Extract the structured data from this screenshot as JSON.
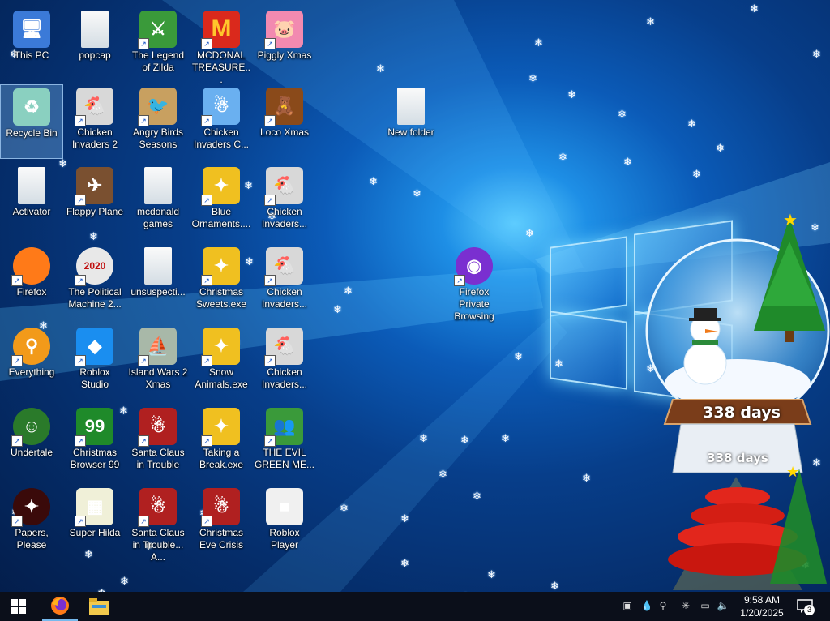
{
  "desktop": {
    "icons": [
      {
        "label": "This PC",
        "icon": "computer-icon",
        "shortcut": false
      },
      {
        "label": "Recycle Bin",
        "icon": "recycle-bin-icon",
        "shortcut": false
      },
      {
        "label": "Activator",
        "icon": "folder-icon",
        "shortcut": false
      },
      {
        "label": "Firefox",
        "icon": "firefox-icon",
        "shortcut": true
      },
      {
        "label": "Everything",
        "icon": "everything-search-icon",
        "shortcut": true
      },
      {
        "label": "Undertale",
        "icon": "undertale-icon",
        "shortcut": true
      },
      {
        "label": "Papers, Please",
        "icon": "papers-please-icon",
        "shortcut": true
      },
      {
        "label": "popcap",
        "icon": "folder-icon",
        "shortcut": false
      },
      {
        "label": "Chicken Invaders 2",
        "icon": "chicken-invaders-icon",
        "shortcut": true
      },
      {
        "label": "Flappy Plane",
        "icon": "flappy-plane-icon",
        "shortcut": true
      },
      {
        "label": "The Political Machine 2...",
        "icon": "political-machine-icon",
        "shortcut": true
      },
      {
        "label": "Roblox Studio",
        "icon": "roblox-studio-icon",
        "shortcut": true
      },
      {
        "label": "Christmas Browser 99",
        "icon": "christmas-tree-icon",
        "shortcut": true
      },
      {
        "label": "Super Hilda",
        "icon": "super-hilda-icon",
        "shortcut": true
      },
      {
        "label": "The Legend of Zilda",
        "icon": "zilda-icon",
        "shortcut": true
      },
      {
        "label": "Angry Birds Seasons",
        "icon": "angry-birds-icon",
        "shortcut": true
      },
      {
        "label": "mcdonald games",
        "icon": "folder-icon",
        "shortcut": false
      },
      {
        "label": "unsuspecti...",
        "icon": "folder-icon",
        "shortcut": false
      },
      {
        "label": "Island Wars 2 Xmas",
        "icon": "island-wars-icon",
        "shortcut": true
      },
      {
        "label": "Santa Claus in Trouble",
        "icon": "santa-icon",
        "shortcut": true
      },
      {
        "label": "Santa Claus in Trouble... A...",
        "icon": "santa-icon",
        "shortcut": true
      },
      {
        "label": "MCDONAL TREASURE...",
        "icon": "mcdonalds-icon",
        "shortcut": true
      },
      {
        "label": "Chicken Invaders C...",
        "icon": "snowman-icon",
        "shortcut": true
      },
      {
        "label": "Blue Ornaments....",
        "icon": "ornaments-icon",
        "shortcut": true
      },
      {
        "label": "Christmas Sweets.exe",
        "icon": "ornaments-icon",
        "shortcut": true
      },
      {
        "label": "Snow Animals.exe",
        "icon": "ornaments-icon",
        "shortcut": true
      },
      {
        "label": "Taking a Break.exe",
        "icon": "ornaments-icon",
        "shortcut": true
      },
      {
        "label": "Christmas Eve Crisis",
        "icon": "santa-icon",
        "shortcut": true
      },
      {
        "label": "Piggly Xmas",
        "icon": "pig-icon",
        "shortcut": true
      },
      {
        "label": "Loco Xmas",
        "icon": "teddy-bear-icon",
        "shortcut": true
      },
      {
        "label": "Chicken Invaders...",
        "icon": "chicken-invaders-icon",
        "shortcut": true
      },
      {
        "label": "Chicken Invaders...",
        "icon": "chicken-invaders-icon",
        "shortcut": true
      },
      {
        "label": "Chicken Invaders...",
        "icon": "chicken-invaders-icon",
        "shortcut": true
      },
      {
        "label": "THE EVIL GREEN ME...",
        "icon": "messenger-icon",
        "shortcut": true
      },
      {
        "label": "Roblox Player",
        "icon": "roblox-icon",
        "shortcut": false
      },
      {
        "label": "New folder",
        "icon": "folder-icon",
        "shortcut": false
      },
      {
        "label": "Firefox Private Browsing",
        "icon": "firefox-private-icon",
        "shortcut": true
      }
    ]
  },
  "gadget": {
    "days_label": "338 days",
    "days_label_base": "338 days"
  },
  "taskbar": {
    "start": "windows-start-icon",
    "pinned": [
      {
        "name": "firefox-icon"
      },
      {
        "name": "file-explorer-icon"
      }
    ],
    "clock": {
      "time": "9:58 AM",
      "date": "1/20/2025"
    },
    "notification_count": "3"
  },
  "colors": {
    "accent": "#0b5bb8",
    "taskbar": "#0b0f1a"
  }
}
